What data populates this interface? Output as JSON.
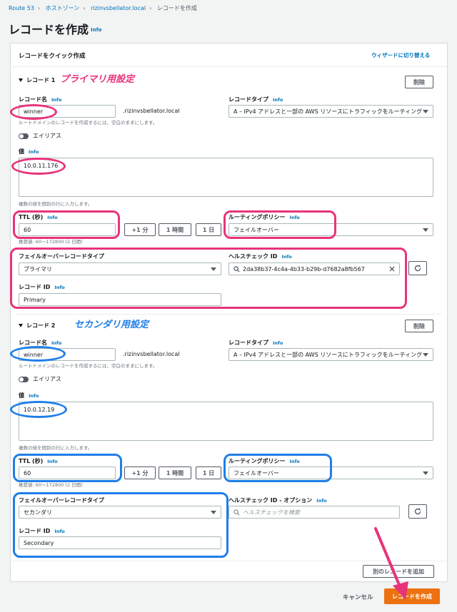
{
  "breadcrumb": [
    "Route 53",
    "ホストゾーン",
    "rizinvsbellator.local",
    "レコードを作成"
  ],
  "page": {
    "title": "レコードを作成",
    "info": "Info"
  },
  "panel": {
    "title": "レコードをクイック作成",
    "wizard_link": "ウィザードに切り替える"
  },
  "info": "Info",
  "labels": {
    "record_name": "レコード名",
    "record_type": "レコードタイプ",
    "alias": "エイリアス",
    "value": "値",
    "ttl": "TTL (秒)",
    "routing_policy": "ルーティングポリシー",
    "failover_type": "フェイルオーバーレコードタイプ",
    "health_check": "ヘルスチェック ID",
    "health_check_optional": "ヘルスチェック ID - オプション",
    "record_id": "レコード ID"
  },
  "hints": {
    "record_name": "ルートドメインのレコードを作成するには、空白のままにします。",
    "value": "複数の値を個別の行に入力します。",
    "ttl": "推奨値: 60～172800 (2 日間)"
  },
  "buttons": {
    "delete": "削除",
    "plus1min": "+1 分",
    "one_hour": "1 時間",
    "one_day": "1 日",
    "add_record": "別のレコードを追加",
    "cancel": "キャンセル",
    "create": "レコードを作成"
  },
  "domain_suffix": ".rizinvsbellator.local",
  "record_type_value": "A – IPv4 アドレスと一部の AWS リソースにトラフィックをルーティング...",
  "routing_policy_value": "フェイルオーバー",
  "record1": {
    "header": "レコード 1",
    "annotation": "プライマリ用設定",
    "name": "winner",
    "value": "10.0.11.176",
    "ttl": "60",
    "failover_type": "プライマリ",
    "health_check_id": "2da38b37-4c4a-4b33-b29b-d7682a8fb567",
    "record_id": "Primary"
  },
  "record2": {
    "header": "レコード 2",
    "annotation": "セカンダリ用設定",
    "name": "winner",
    "value": "10.0.12.19",
    "ttl": "60",
    "failover_type": "セカンダリ",
    "health_check_placeholder": "ヘルスチェックを検索",
    "record_id": "Secondary"
  },
  "colors": {
    "annotation_pink": "#e8337a",
    "annotation_blue": "#1f7ee8",
    "primary_button": "#ec7211",
    "link": "#0073bb"
  }
}
